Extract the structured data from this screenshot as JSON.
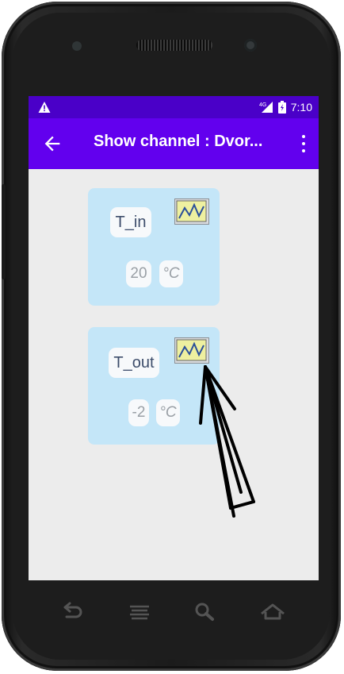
{
  "status_bar": {
    "time": "7:10",
    "network": "4G",
    "icons": [
      "warning-icon",
      "signal-icon",
      "battery-icon"
    ]
  },
  "app_bar": {
    "title": "Show channel : Dvor...",
    "back_icon": "arrow-back-icon",
    "menu_icon": "more-vert-icon"
  },
  "channels": [
    {
      "name": "T_in",
      "value": "20",
      "unit": "°C",
      "chart_icon": "line-chart-icon"
    },
    {
      "name": "T_out",
      "value": "-2",
      "unit": "°C",
      "chart_icon": "line-chart-icon"
    }
  ],
  "nav_bar": {
    "icons": [
      "back-nav-icon",
      "menu-nav-icon",
      "search-nav-icon",
      "home-nav-icon"
    ]
  },
  "colors": {
    "status_bar": "#4a00c8",
    "app_bar": "#6200ee",
    "card": "#c4e6f8",
    "screen_bg": "#ececec"
  }
}
